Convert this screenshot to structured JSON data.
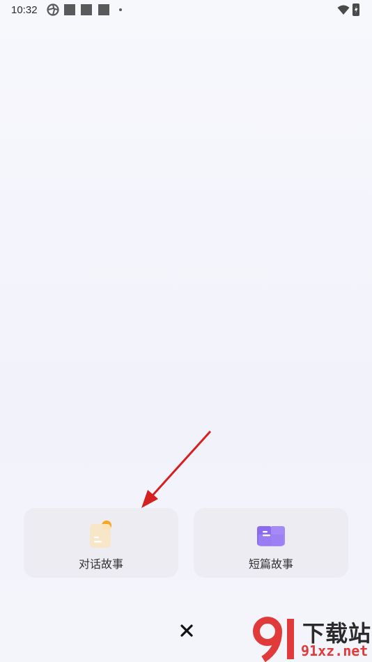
{
  "status_bar": {
    "time": "10:32",
    "icons_left": [
      "vpn-icon",
      "notification-square-icon",
      "notification-square-icon",
      "notification-square-icon",
      "more-dot-icon"
    ],
    "icons_right": [
      "wifi-icon",
      "battery-charging-icon"
    ]
  },
  "cards": [
    {
      "label": "对话故事",
      "icon": "chat-story-icon"
    },
    {
      "label": "短篇故事",
      "icon": "book-icon"
    }
  ],
  "close_icon": "close-icon",
  "colors": {
    "card_bg": "#ececf2",
    "arrow": "#d42020",
    "book_purple": "#8b6cf0",
    "chat_orange": "#f5a623"
  },
  "watermark": {
    "chars": "下载站",
    "domain": "91xz.net"
  }
}
